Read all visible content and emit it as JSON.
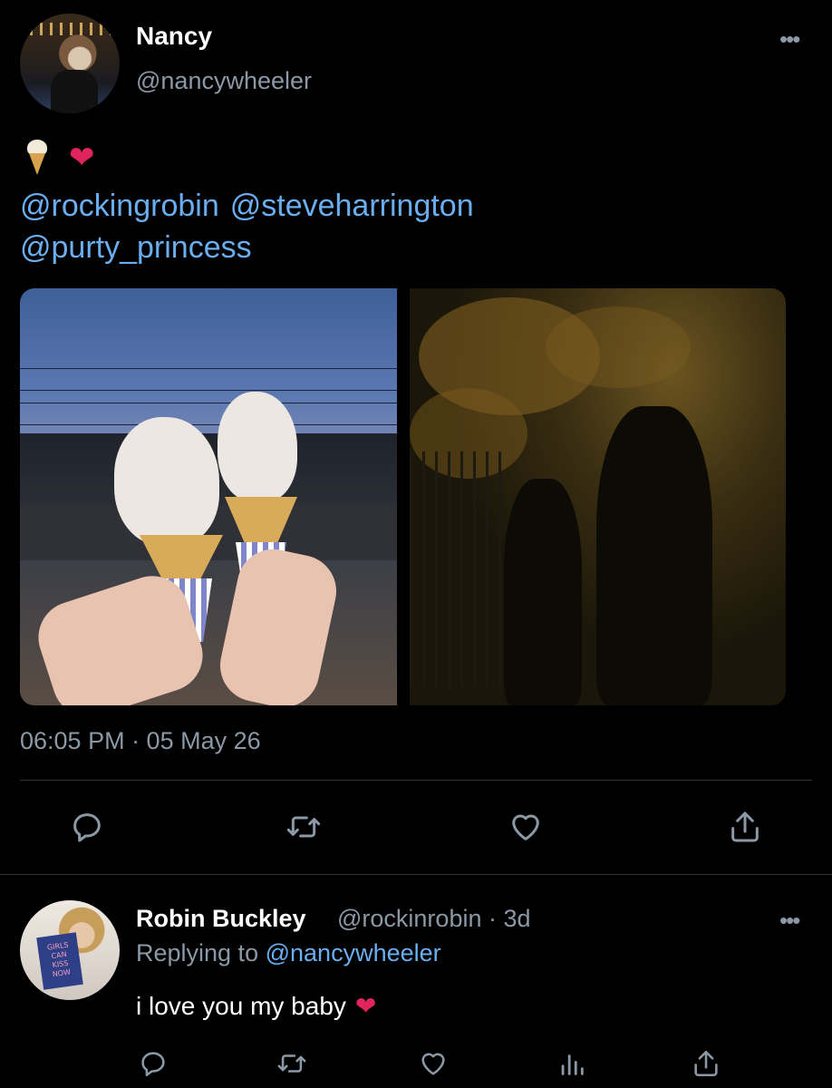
{
  "tweet": {
    "author_name": "Nancy",
    "author_handle": "@nancywheeler",
    "emoji_icons": [
      "soft-ice-cream-icon",
      "red-heart-icon"
    ],
    "mentions": [
      "@rockingrobin",
      "@steveharrington",
      "@purty_princess"
    ],
    "media": [
      {
        "name": "ice-cream-cones-photo"
      },
      {
        "name": "night-walk-photo"
      }
    ],
    "timestamp": "06:05 PM · 05 May 26",
    "actions": [
      "reply-icon",
      "retweet-icon",
      "like-icon",
      "share-icon"
    ]
  },
  "reply": {
    "author_name": "Robin Buckley",
    "meta": "@rockinrobin · 3d",
    "replying_prefix": "Replying to",
    "replying_to": "@nancywheeler",
    "text": "i love you my baby",
    "avatar_book_text": "GIRLS CAN KISS NOW",
    "actions": [
      "reply-icon",
      "retweet-icon",
      "like-icon",
      "analytics-icon",
      "share-icon"
    ]
  },
  "colors": {
    "background": "#000000",
    "link": "#6aaef0",
    "muted": "#8b98a5",
    "divider": "#2f3336",
    "heart": "#e0245e"
  }
}
